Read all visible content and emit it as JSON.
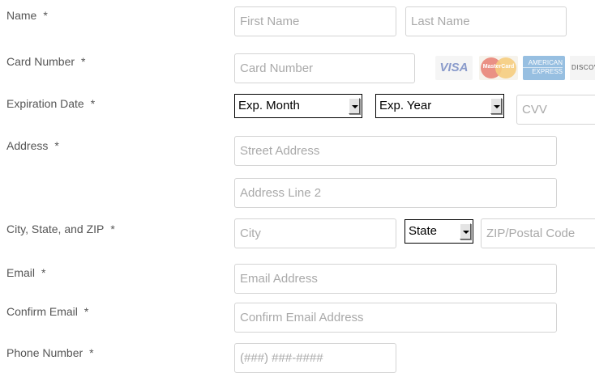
{
  "form": {
    "required_mark": "*",
    "name": {
      "label": "Name",
      "first_placeholder": "First Name",
      "last_placeholder": "Last Name"
    },
    "card_number": {
      "label": "Card Number",
      "placeholder": "Card Number",
      "logos": {
        "visa": "VISA",
        "mastercard": "MasterCard",
        "amex_line1": "AMERICAN",
        "amex_line2": "EXPRESS",
        "discover": "DISCOVER"
      }
    },
    "expiration": {
      "label": "Expiration Date",
      "month_value": "Exp. Month",
      "year_value": "Exp. Year",
      "cvv_placeholder": "CVV"
    },
    "address": {
      "label": "Address",
      "street_placeholder": "Street Address",
      "line2_placeholder": "Address Line 2"
    },
    "city_state_zip": {
      "label": "City, State, and ZIP",
      "city_placeholder": "City",
      "state_value": "State",
      "zip_placeholder": "ZIP/Postal Code"
    },
    "email": {
      "label": "Email",
      "placeholder": "Email Address"
    },
    "confirm_email": {
      "label": "Confirm Email",
      "placeholder": "Confirm Email Address"
    },
    "phone": {
      "label": "Phone Number",
      "placeholder": "(###) ###-####"
    }
  },
  "colors": {
    "field_border": "#d4d4d4",
    "placeholder": "#a9a9a9",
    "label_text": "#555555"
  }
}
